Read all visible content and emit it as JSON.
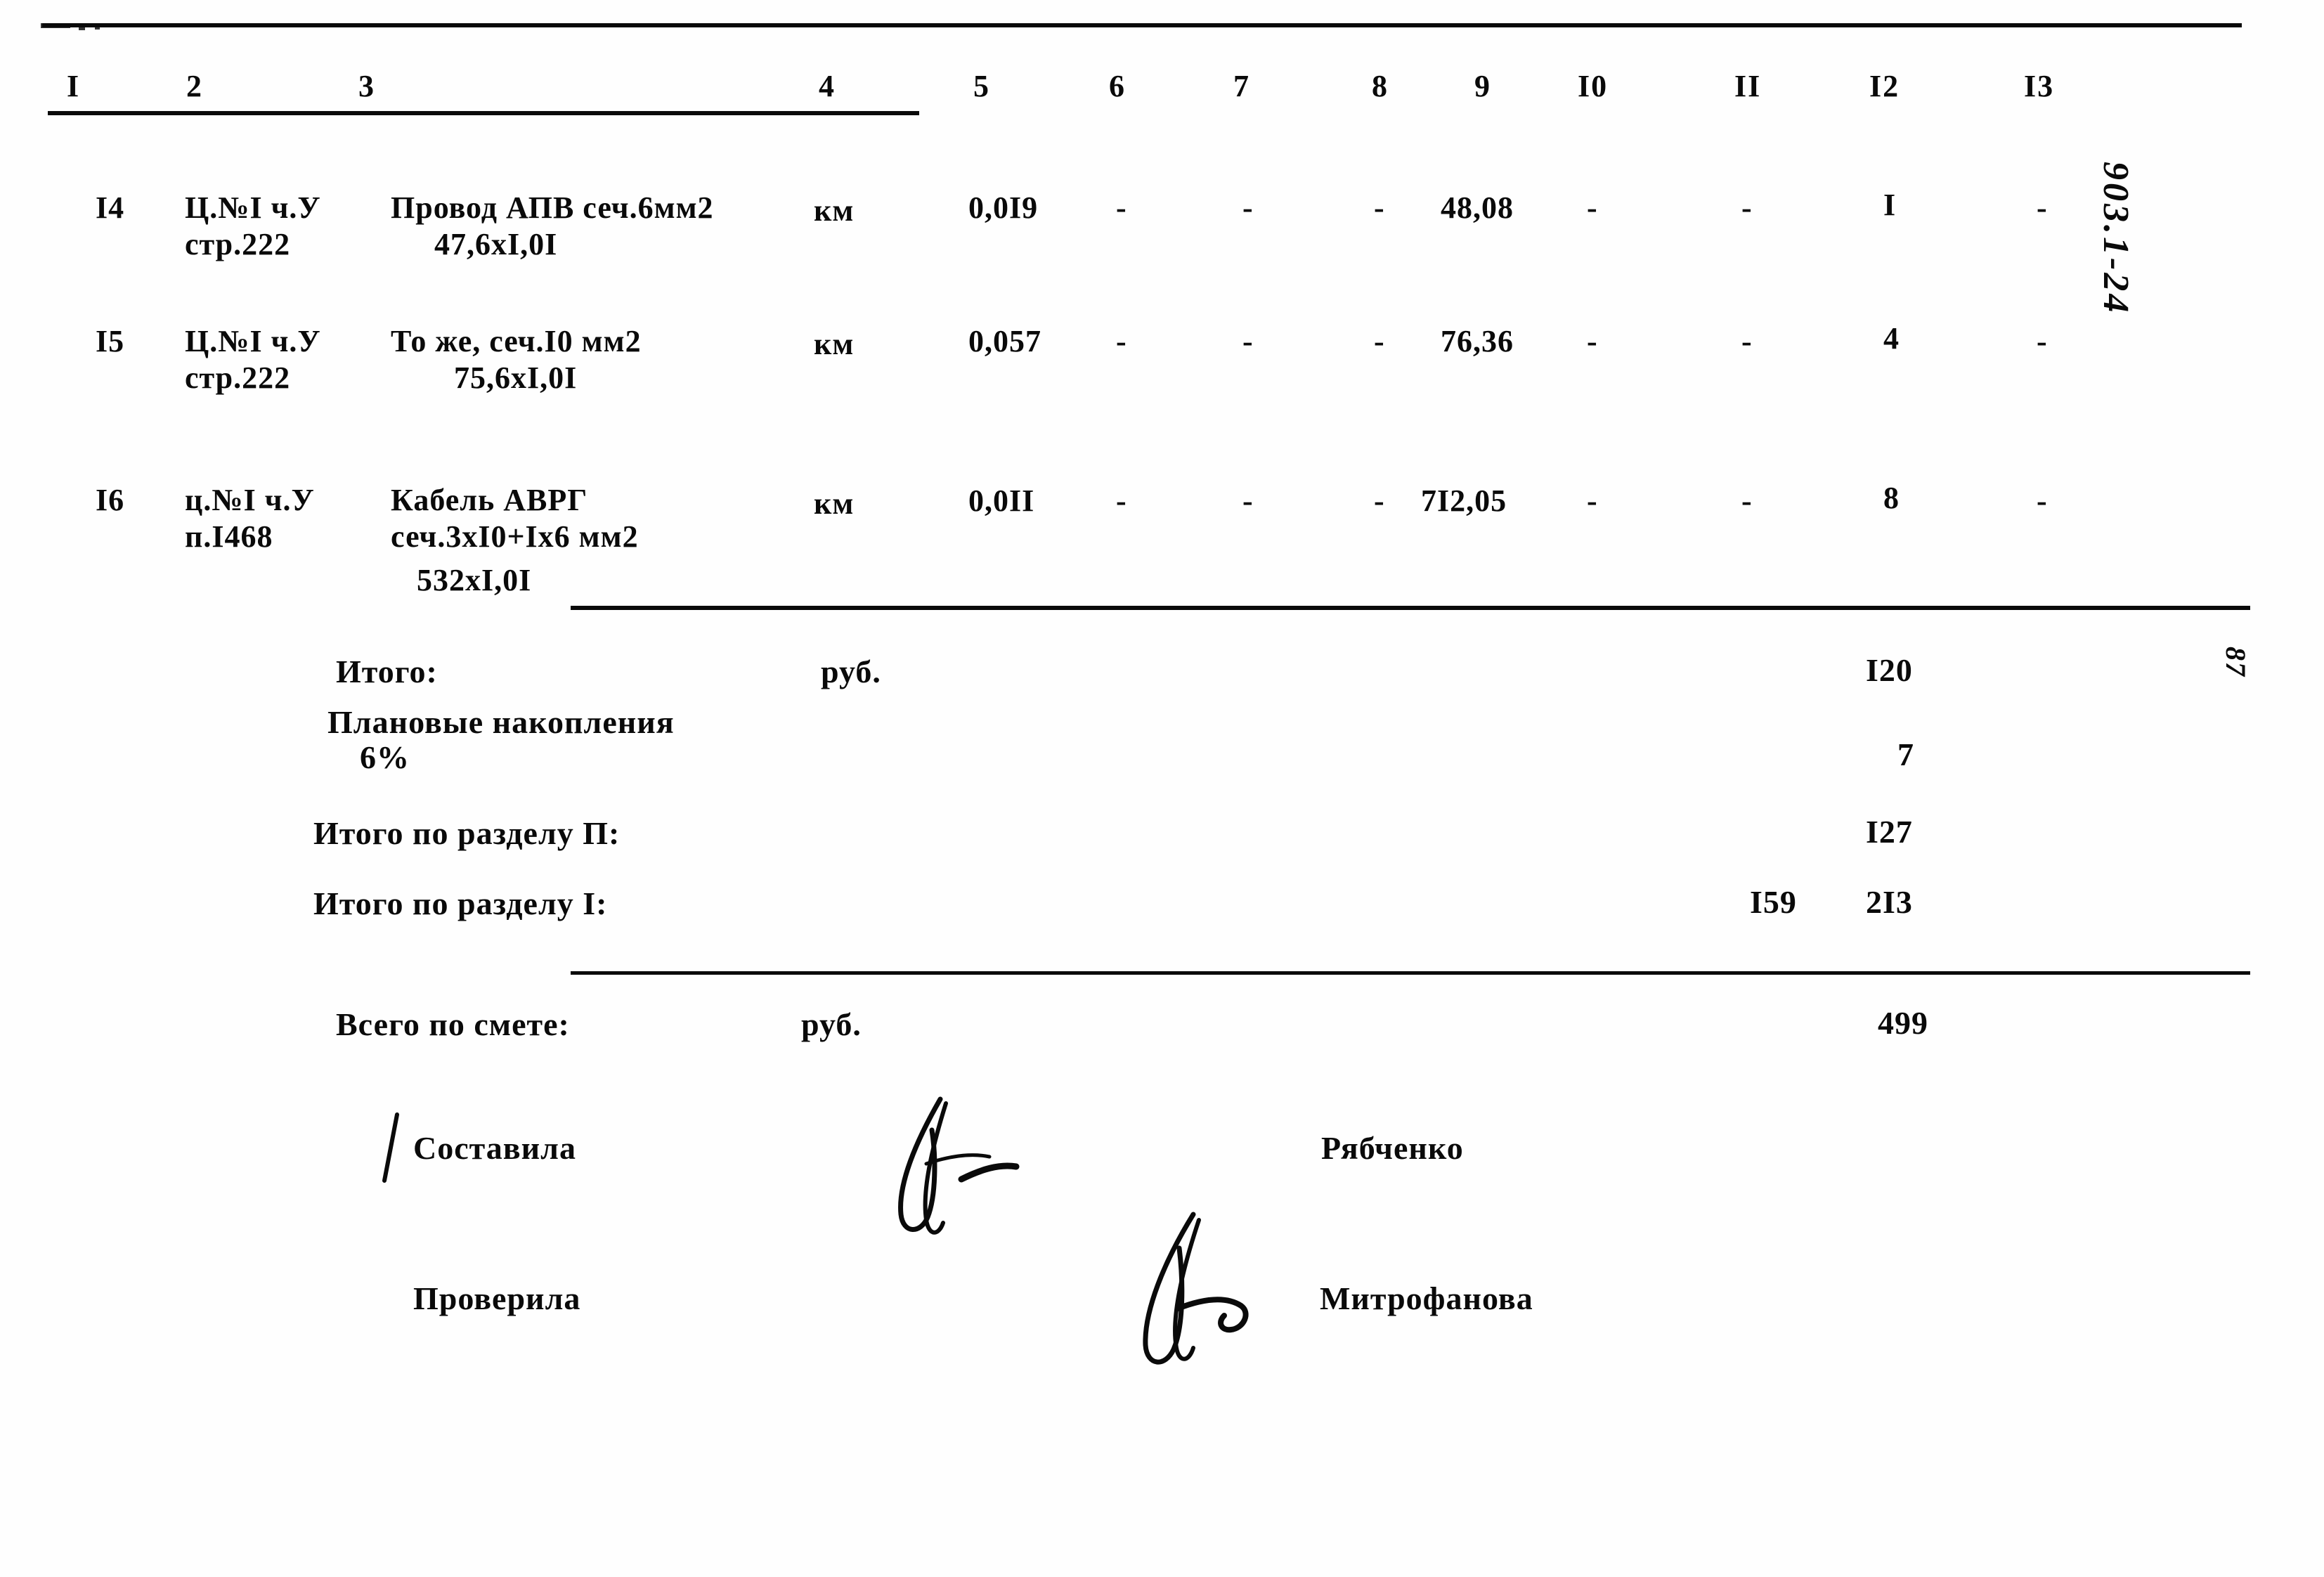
{
  "document": {
    "kind": "construction-cost-estimate-table",
    "margin_annotation_right": "903.1-24",
    "page_number_right": "87"
  },
  "table": {
    "column_headers": [
      "I",
      "2",
      "3",
      "4",
      "5",
      "6",
      "7",
      "8",
      "9",
      "I0",
      "II",
      "I2",
      "I3"
    ],
    "rows": [
      {
        "num": "I4",
        "justification_line1": "Ц.№I ч.У",
        "justification_line2": "стр.222",
        "description_line1": "Провод АПВ сеч.6мм2",
        "description_line2": "47,6xI,0I",
        "description_line3": "",
        "unit": "км",
        "c5": "0,0I9",
        "c6": "-",
        "c7": "-",
        "c8": "-",
        "c9": "48,08",
        "c10": "-",
        "c11": "-",
        "c12": "I",
        "c13": "-"
      },
      {
        "num": "I5",
        "justification_line1": "Ц.№I ч.У",
        "justification_line2": "стр.222",
        "description_line1": "То же, сеч.I0 мм2",
        "description_line2": "75,6xI,0I",
        "description_line3": "",
        "unit": "км",
        "c5": "0,057",
        "c6": "-",
        "c7": "-",
        "c8": "-",
        "c9": "76,36",
        "c10": "-",
        "c11": "-",
        "c12": "4",
        "c13": "-"
      },
      {
        "num": "I6",
        "justification_line1": "ц.№I ч.У",
        "justification_line2": "п.I468",
        "description_line1": "Кабель АВРГ",
        "description_line2": "сеч.3xI0+Ix6 мм2",
        "description_line3": "532xI,0I",
        "unit": "км",
        "c5": "0,0II",
        "c6": "-",
        "c7": "-",
        "c8": "-",
        "c9": "7I2,05",
        "c10": "-",
        "c11": "-",
        "c12": "8",
        "c13": "-"
      }
    ]
  },
  "totals": {
    "rows": [
      {
        "label": "Итого:",
        "unit": "руб.",
        "c11": "",
        "c12": "I20"
      },
      {
        "label": "Плановые накопления",
        "label2": "6%",
        "unit": "",
        "c11": "",
        "c12": "7"
      },
      {
        "label": "Итого по разделу П:",
        "unit": "",
        "c11": "",
        "c12": "I27"
      },
      {
        "label": "Итого по разделу I:",
        "unit": "",
        "c11": "I59",
        "c12": "2I3"
      }
    ],
    "grand": {
      "label": "Всего по смете:",
      "unit": "руб.",
      "c12": "499"
    }
  },
  "signatures": [
    {
      "role": "Составила",
      "name": "Рябченко"
    },
    {
      "role": "Проверила",
      "name": "Митрофанова"
    }
  ]
}
